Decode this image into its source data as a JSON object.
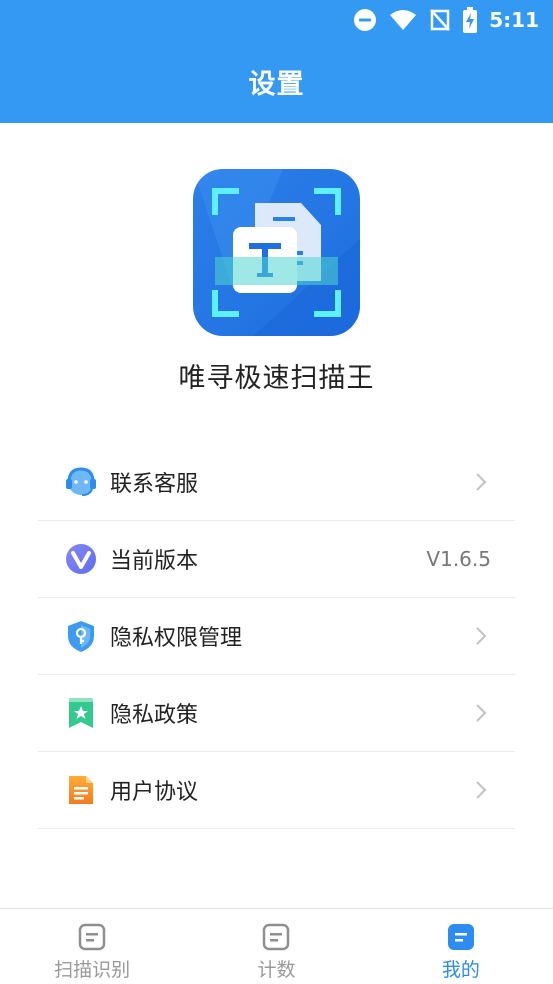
{
  "status_bar": {
    "time": "5:11",
    "icons": [
      "do-not-disturb-icon",
      "wifi-icon",
      "no-signal-icon",
      "battery-charging-icon"
    ]
  },
  "header": {
    "title": "设置"
  },
  "app_info": {
    "name": "唯寻极速扫描王",
    "icon": "scan-text-icon"
  },
  "settings": {
    "items": [
      {
        "label": "联系客服",
        "icon": "customer-service-icon"
      },
      {
        "label": "当前版本",
        "icon": "version-icon",
        "value": "V1.6.5"
      },
      {
        "label": "隐私权限管理",
        "icon": "privacy-shield-icon"
      },
      {
        "label": "隐私政策",
        "icon": "policy-bookmark-icon"
      },
      {
        "label": "用户协议",
        "icon": "document-icon"
      }
    ]
  },
  "bottom_nav": {
    "items": [
      {
        "label": "扫描识别",
        "icon": "scan-tab-icon",
        "active": false
      },
      {
        "label": "计数",
        "icon": "count-tab-icon",
        "active": false
      },
      {
        "label": "我的",
        "icon": "profile-tab-icon",
        "active": true
      }
    ]
  },
  "colors": {
    "primary": "#3399f3",
    "active_tab": "#2d8cf0",
    "inactive_tab": "#999999"
  }
}
